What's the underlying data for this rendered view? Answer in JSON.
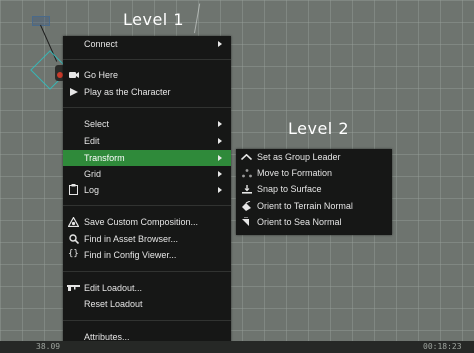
{
  "annotations": {
    "level1": "Level 1",
    "level2": "Level 2"
  },
  "context_menu": {
    "items": [
      {
        "label": "Connect",
        "has_submenu": true
      },
      {
        "label": "Go Here",
        "icon": "camera-icon"
      },
      {
        "label": "Play as the Character",
        "icon": "play-icon"
      },
      {
        "label": "Select",
        "has_submenu": true
      },
      {
        "label": "Edit",
        "has_submenu": true
      },
      {
        "label": "Transform",
        "has_submenu": true,
        "highlighted": true
      },
      {
        "label": "Grid",
        "has_submenu": true
      },
      {
        "label": "Log",
        "icon": "clipboard-icon",
        "has_submenu": true
      },
      {
        "label": "Save Custom Composition...",
        "icon": "composition-icon"
      },
      {
        "label": "Find in Asset Browser...",
        "icon": "magnifier-icon"
      },
      {
        "label": "Find in Config Viewer...",
        "icon": "braces-icon"
      },
      {
        "label": "Edit Loadout...",
        "icon": "rifle-icon"
      },
      {
        "label": "Reset Loadout"
      },
      {
        "label": "Attributes..."
      }
    ]
  },
  "submenu": {
    "items": [
      {
        "label": "Set as Group Leader",
        "icon": "leader-icon"
      },
      {
        "label": "Move to Formation",
        "icon": "formation-icon"
      },
      {
        "label": "Snap to Surface",
        "icon": "snap-surface-icon"
      },
      {
        "label": "Orient to Terrain Normal",
        "icon": "terrain-normal-icon"
      },
      {
        "label": "Orient to Sea Normal",
        "icon": "sea-normal-icon"
      }
    ]
  },
  "status_bar": {
    "left_value": "38.09",
    "right_time": "00:18:23"
  },
  "colors": {
    "menu_background": "#161716",
    "highlight": "#2f8a3a",
    "viewport": "#6e746f"
  }
}
